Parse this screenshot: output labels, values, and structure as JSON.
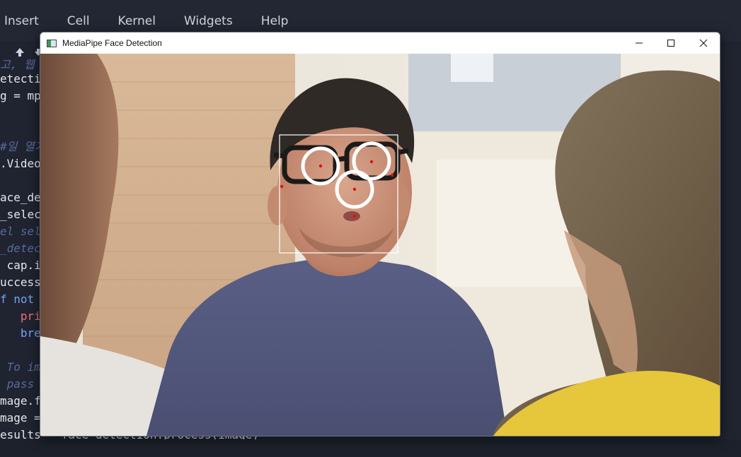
{
  "menubar": {
    "items": [
      "Insert",
      "Cell",
      "Kernel",
      "Widgets",
      "Help"
    ]
  },
  "editor": {
    "lines": [
      {
        "text": "고, 웹",
        "style": "cm"
      },
      {
        "text": "etectio",
        "style": "plain"
      },
      {
        "text": "g = mp",
        "style": "plain"
      },
      {
        "text": "",
        "style": "plain"
      },
      {
        "text": "#일 열기",
        "style": "cm"
      },
      {
        "text": ".Video",
        "style": "plain"
      },
      {
        "text": "",
        "style": "plain"
      },
      {
        "text": "ace_de",
        "style": "plain"
      },
      {
        "text": "_selec",
        "style": "plain"
      },
      {
        "text": "el sel",
        "style": "cm"
      },
      {
        "text": "_detec",
        "style": "cm"
      },
      {
        "text": " cap.i",
        "style": "plain"
      },
      {
        "text": "uccess",
        "style": "plain"
      },
      {
        "text": "f not ",
        "style": "kw"
      },
      {
        "text": "   pri",
        "style": "red"
      },
      {
        "text": "   bre",
        "style": "blue"
      },
      {
        "text": "",
        "style": "plain"
      },
      {
        "text": " To im",
        "style": "cm"
      },
      {
        "text": " pass ",
        "style": "cm"
      },
      {
        "text": "mage.f",
        "style": "plain"
      },
      {
        "text": "mage = ",
        "style": "plain"
      },
      {
        "text": "esults = face_detection.process(image)",
        "style": "plain"
      }
    ]
  },
  "window": {
    "title": "MediaPipe Face Detection",
    "controls": {
      "minimize": "minimize",
      "maximize": "maximize",
      "close": "close"
    }
  },
  "detection": {
    "keypoints": 6,
    "colors": {
      "box": "#ffffff",
      "keypoint_ring": "#ffffff",
      "keypoint_dot": "#e01010"
    }
  }
}
